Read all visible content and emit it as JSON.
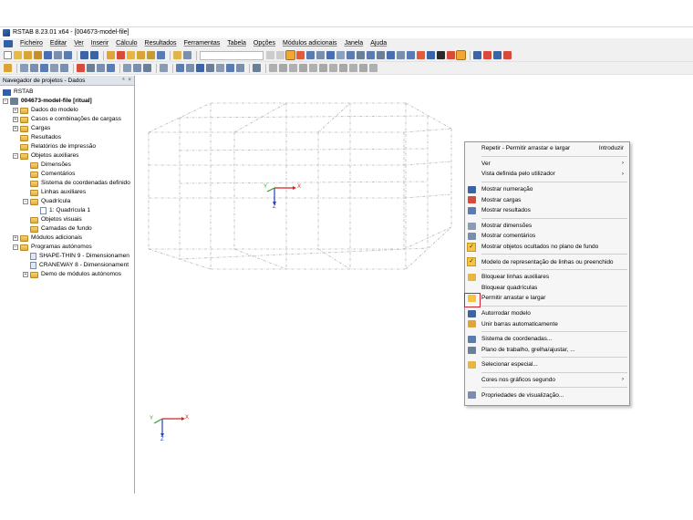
{
  "window": {
    "title": "RSTAB 8.23.01 x64 - [004673-model-file]"
  },
  "menu": {
    "items": [
      "Ficheiro",
      "Editar",
      "Ver",
      "Inserir",
      "Cálculo",
      "Resultados",
      "Ferramentas",
      "Tabela",
      "Opções",
      "Módulos adicionais",
      "Janela",
      "Ajuda"
    ]
  },
  "navigator": {
    "title": "Navegador de projetos - Dados",
    "header_buttons": [
      "ᵃ",
      "×"
    ],
    "root": "RSTAB",
    "model": "004673-model-file [ritual]",
    "items": [
      "Dados do modelo",
      "Casos e combinações de cargass",
      "Cargas",
      "Resultados",
      "Relatórios de impressão",
      "Objetos auxiliares",
      "Dimensões",
      "Comentários",
      "Sistema de coordenadas definido",
      "Linhas auxiliares",
      "Quadrícula",
      "1: Quadrícula 1",
      "Objetos visuais",
      "Camadas de fundo",
      "Módulos adicionais",
      "Programas autónomos",
      "SHAPE-THIN 9 - Dimensionamen",
      "CRANEWAY 8 - Dimensionament",
      "Demo de módulos autónomos"
    ]
  },
  "axes": {
    "x": "X",
    "y": "Y",
    "z": "Z"
  },
  "context_menu": {
    "items": [
      {
        "label": "Repetir - Permitir arrastar e largar",
        "shortcut": "Introduzir"
      },
      {
        "label": "Ver",
        "submenu": "›"
      },
      {
        "label": "Vista definida pelo utilizador",
        "submenu": "›"
      },
      {
        "label": "Mostrar numeração"
      },
      {
        "label": "Mostrar cargas"
      },
      {
        "label": "Mostrar resultados"
      },
      {
        "label": "Mostrar dimensões"
      },
      {
        "label": "Mostrar comentários"
      },
      {
        "label": "Mostrar objetos ocultados no plano de fundo",
        "check": "✓"
      },
      {
        "label": "Modelo de representação de linhas ou preenchido",
        "check": "✓"
      },
      {
        "label": "Bloquear linhas auxiliares"
      },
      {
        "label": "Bloquear quadrículas"
      },
      {
        "label": "Permitir arrastar e largar"
      },
      {
        "label": "Autorrodar modelo"
      },
      {
        "label": "Unir barras automaticamente"
      },
      {
        "label": "Sistema de coordenadas..."
      },
      {
        "label": "Plano de trabalho, grelha/ajustar, ..."
      },
      {
        "label": "Selecionar especial..."
      },
      {
        "label": "Cores nos gráficos segundo",
        "submenu": "›"
      },
      {
        "label": "Propriedades de visualização..."
      }
    ]
  },
  "colors": {
    "accent": "#2f5fa8",
    "highlight_box": "#d0202a",
    "check_fill": "#f5c542",
    "folder": "#e3ad3c"
  }
}
